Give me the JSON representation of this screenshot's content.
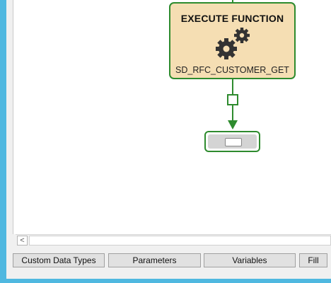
{
  "node": {
    "title": "EXECUTE FUNCTION",
    "function_name": "SD_RFC_CUSTOMER_GET",
    "icon": "gears-icon"
  },
  "scrollbar": {
    "left_arrow": "<"
  },
  "tabs": [
    {
      "label": "Custom Data Types"
    },
    {
      "label": "Parameters"
    },
    {
      "label": "Variables"
    },
    {
      "label": "Fill"
    }
  ],
  "colors": {
    "accent_border": "#2e8b2e",
    "node_fill": "#f5deb3",
    "window_frame": "#4fb8e0"
  }
}
